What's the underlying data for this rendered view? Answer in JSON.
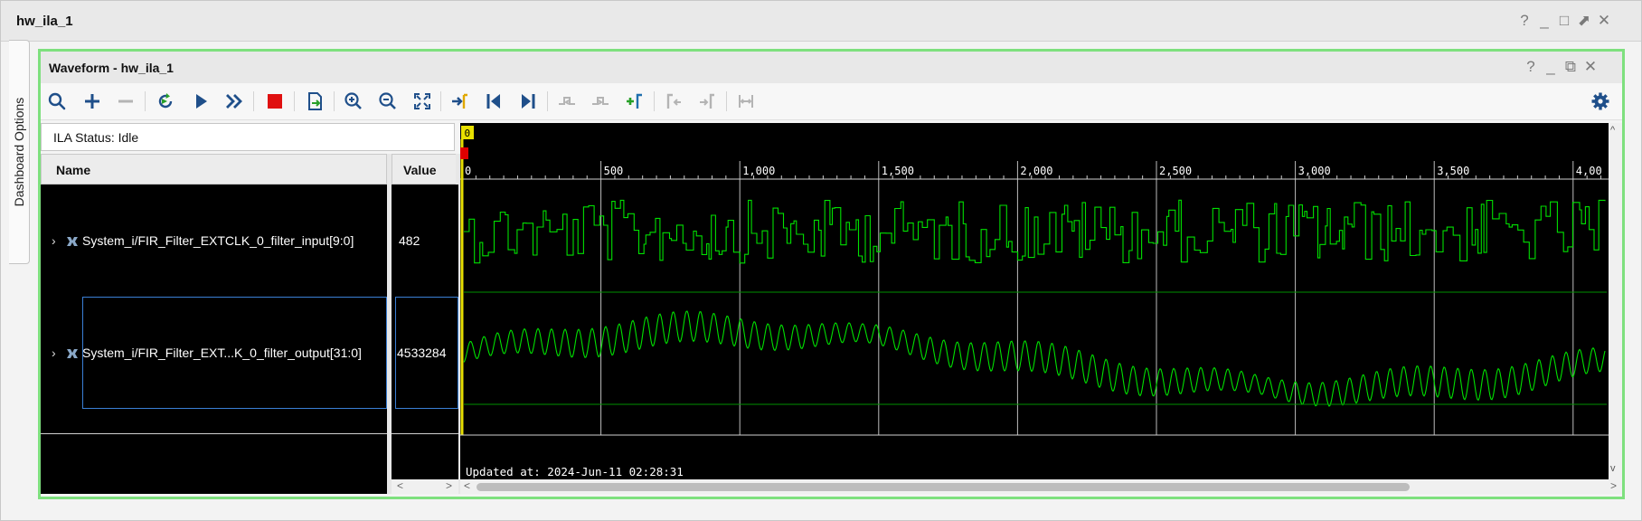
{
  "outer": {
    "title": "hw_ila_1",
    "controls": [
      "?",
      "_",
      "□",
      "⬈",
      "✕"
    ]
  },
  "side_tab": {
    "label": "Dashboard Options"
  },
  "panel": {
    "title": "Waveform - hw_ila_1",
    "controls": [
      "?",
      "_",
      "⧉",
      "✕"
    ]
  },
  "toolbar": {
    "icons": [
      "search-icon",
      "add-icon",
      "remove-icon",
      "refresh-icon",
      "run-icon",
      "run-continuous-icon",
      "stop-icon",
      "export-icon",
      "zoom-in-icon",
      "zoom-out-icon",
      "zoom-fit-icon",
      "go-to-cursor-icon",
      "go-to-start-icon",
      "go-to-end-icon",
      "previous-transition-icon",
      "next-transition-icon",
      "add-marker-icon",
      "previous-marker-icon",
      "next-marker-icon",
      "swap-cursors-icon",
      "settings-icon"
    ]
  },
  "status": {
    "label": "ILA Status:",
    "value": "Idle",
    "text": "ILA Status:  Idle"
  },
  "columns": {
    "name": "Name",
    "value": "Value"
  },
  "signals": [
    {
      "name": "System_i/FIR_Filter_EXTCLK_0_filter_input[9:0]",
      "value": "482"
    },
    {
      "name": "System_i/FIR_Filter_EXT...K_0_filter_output[31:0]",
      "value": "4533284"
    }
  ],
  "waveform": {
    "marker_label": "0",
    "ruler_ticks": [
      "0",
      "500",
      "1,000",
      "1,500",
      "2,000",
      "2,500",
      "3,000",
      "3,500",
      "4,00"
    ],
    "updated_text": "Updated at: 2024-Jun-11 02:28:31",
    "colors": {
      "wave": "#00e000",
      "cursor": "#e8e000",
      "trigger": "#e00000",
      "grid": "#ffffff"
    }
  }
}
